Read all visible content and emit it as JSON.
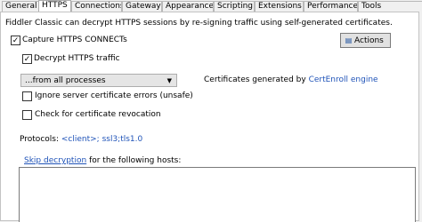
{
  "tabs": [
    {
      "label": "General",
      "active": false
    },
    {
      "label": "HTTPS",
      "active": true
    },
    {
      "label": "Connections",
      "active": false
    },
    {
      "label": "Gateway",
      "active": false
    },
    {
      "label": "Appearance",
      "active": false
    },
    {
      "label": "Scripting",
      "active": false
    },
    {
      "label": "Extensions",
      "active": false
    },
    {
      "label": "Performance",
      "active": false
    },
    {
      "label": "Tools",
      "active": false
    }
  ],
  "https": {
    "description": "Fiddler Classic can decrypt HTTPS sessions by re-signing traffic using self-generated certificates.",
    "capture_connects": {
      "label": "Capture HTTPS CONNECTs",
      "checked": true
    },
    "decrypt_traffic": {
      "label": "Decrypt HTTPS traffic",
      "checked": true
    },
    "actions_button": {
      "label": "Actions",
      "icon": "certificate-icon"
    },
    "process_filter": {
      "selected": "...from all processes"
    },
    "certificates": {
      "prefix": "Certificates generated by",
      "engine_link": "CertEnroll engine"
    },
    "ignore_errors": {
      "label": "Ignore server certificate errors (unsafe)",
      "checked": false
    },
    "check_revocation": {
      "label": "Check for certificate revocation",
      "checked": false
    },
    "protocols": {
      "label": "Protocols:",
      "value_link": "<client>; ssl3;tls1.0"
    },
    "skip_decryption": {
      "link": "Skip decryption",
      "suffix": "for the following hosts:"
    },
    "hosts_list": {
      "value": ""
    }
  },
  "colors": {
    "link": "#1f53b8",
    "panel_bg": "#ffffff",
    "window_bg": "#f0f0f0"
  }
}
